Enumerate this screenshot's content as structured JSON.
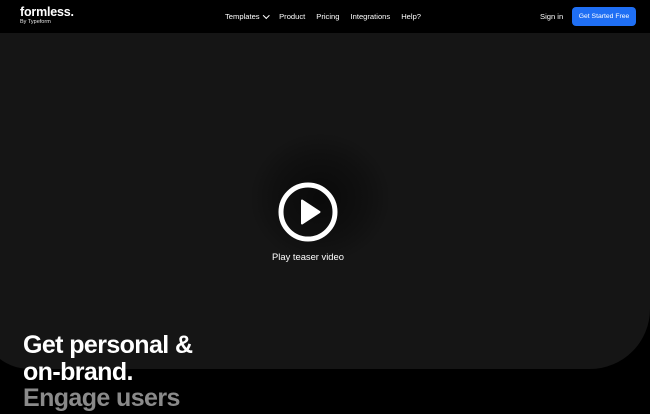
{
  "header": {
    "logo_word": "formless.",
    "logo_sub": "By Typeform",
    "nav": [
      {
        "label": "Templates",
        "has_dropdown": true
      },
      {
        "label": "Product"
      },
      {
        "label": "Pricing"
      },
      {
        "label": "Integrations"
      },
      {
        "label": "Help?"
      }
    ],
    "signin_label": "Sign in",
    "cta_label": "Get Started Free"
  },
  "video": {
    "play_label": "Play teaser video"
  },
  "hero": {
    "line1": "Get personal &",
    "line2": "on-brand.",
    "line3": "Engage users"
  },
  "colors": {
    "background": "#000000",
    "video_panel": "#151515",
    "cta": "#1f6ff4",
    "dim_text": "#8a8a8a"
  }
}
